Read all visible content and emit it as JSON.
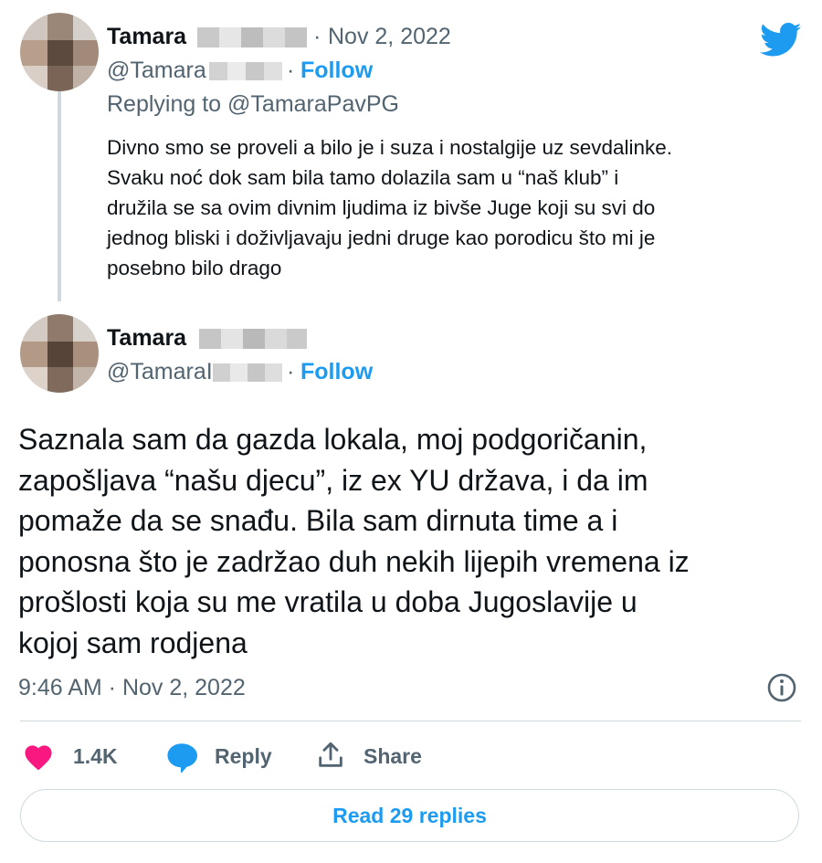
{
  "reply_tweet": {
    "author_name": "Tamara",
    "separator": "·",
    "date": "Nov 2, 2022",
    "handle": "@Tamara",
    "follow_label": "Follow",
    "replying_to_prefix": "Replying to",
    "replying_to_handle": "@TamaraPavPG",
    "text_lines": [
      "Divno smo se proveli a bilo je i suza i nostalgije uz sevdalinke.",
      "Svaku noć dok sam bila tamo dolazila sam u “naš klub” i",
      "družila se sa ovim divnim ljudima iz bivše Juge koji su svi do",
      "jednog bliski i doživljavaju jedni druge kao porodicu što mi je",
      "posebno bilo drago"
    ]
  },
  "main_tweet": {
    "author_name": "Tamara",
    "handle": "@TamaraI",
    "separator": "·",
    "follow_label": "Follow",
    "text_lines": [
      "Saznala sam da gazda lokala, moj podgoričanin,",
      "zapošljava “našu djecu”, iz ex YU država, i da im",
      "pomaže da se snađu. Bila sam dirnuta time a i",
      "ponosna što je zadržao duh nekih lijepih vremena iz",
      "prošlosti koja su me vratila u doba Jugoslavije u",
      "kojoj sam rodjena"
    ],
    "timestamp": "9:46 AM · Nov 2, 2022"
  },
  "actions": {
    "like_count": "1.4K",
    "reply_label": "Reply",
    "share_label": "Share"
  },
  "read_replies_label": "Read 29 replies",
  "icons": {
    "brand": "twitter-bird-icon",
    "info": "info-icon",
    "like": "heart-icon",
    "reply": "speech-bubble-icon",
    "share": "share-upload-icon"
  },
  "colors": {
    "accent": "#1d9bf0",
    "like": "#f91880",
    "text": "#0f1419",
    "secondary": "#536471",
    "border": "#cfd9de"
  }
}
